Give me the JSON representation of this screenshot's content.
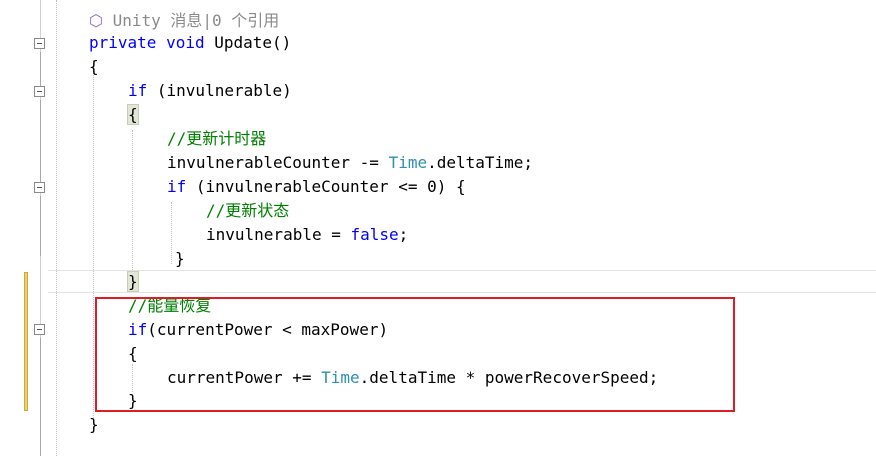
{
  "editor": {
    "codelens": {
      "icon": "unity-cube-icon",
      "text": "Unity 消息|0 个引用"
    },
    "lines": {
      "signature": {
        "modifier": "private",
        "type": "void",
        "name": "Update()"
      },
      "open_brace_method": "{",
      "if_invulnerable": {
        "keyword": "if",
        "rest": " (invulnerable)"
      },
      "open_brace_if1": "{",
      "comment_update_timer": "//更新计时器",
      "counter_stmt": {
        "var": "invulnerableCounter -= ",
        "type": "Time",
        "rest": ".deltaTime;"
      },
      "if_counter": {
        "keyword": "if",
        "rest": " (invulnerableCounter <= 0) {"
      },
      "comment_update_state": "//更新状态",
      "assign_stmt": {
        "var": "invulnerable = ",
        "value": "false",
        "end": ";"
      },
      "close_brace_inner": "}",
      "close_brace_if1": "}",
      "comment_power": "//能量恢复",
      "if_power": {
        "keyword": "if",
        "rest": "(currentPower < maxPower)"
      },
      "open_brace_power": "{",
      "power_stmt": {
        "var": "currentPower += ",
        "type": "Time",
        "rest": ".deltaTime * powerRecoverSpeed;"
      },
      "close_brace_power": "}",
      "close_brace_method": "}"
    }
  },
  "colors": {
    "keyword": "#0000ff",
    "comment": "#008000",
    "type": "#2b91af",
    "codelens": "#8a8a8a",
    "highlight_box": "#dd1c24",
    "change_bar": "#e8d46a"
  }
}
